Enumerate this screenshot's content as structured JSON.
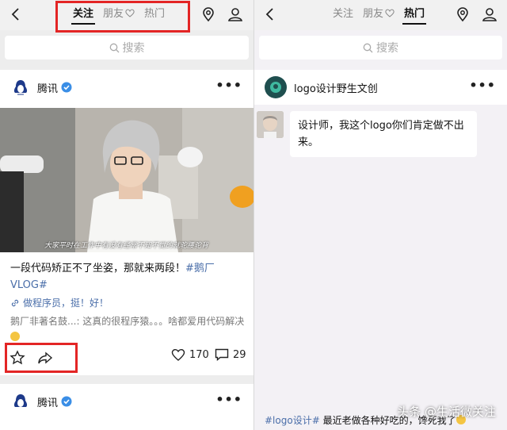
{
  "left": {
    "tabs": [
      {
        "label": "关注",
        "active": true
      },
      {
        "label": "朋友",
        "active": false,
        "icon": "heart-outline-icon"
      },
      {
        "label": "热门",
        "active": false
      }
    ],
    "search_placeholder": "搜索",
    "post": {
      "author": "腾讯",
      "video_caption": "大家平时在工作中有没有经常不知不觉的就驼腰驼背",
      "text": "一段代码矫正不了坐姿，那就来两段！",
      "hashtag": "#鹅厂VLOG#",
      "link": "做程序员，挺！好！",
      "comment": "鹅厂非著名鼓...: 这真的很程序猿。。。啥都爱用代码解决",
      "likes": "170",
      "comments": "29"
    },
    "next_post_author": "腾讯"
  },
  "right": {
    "tabs": [
      {
        "label": "关注",
        "active": false
      },
      {
        "label": "朋友",
        "active": false,
        "icon": "heart-outline-icon"
      },
      {
        "label": "热门",
        "active": true
      }
    ],
    "search_placeholder": "搜索",
    "author": "logo设计野生文创",
    "bubble_text": "设计师，我这个logo你们肯定做不出来。",
    "footer_hashtag": "#logo设计#",
    "footer_text": "最近老做各种好吃的，馋死我了",
    "watermark": "头条 @生活微关注"
  },
  "colors": {
    "highlight_box": "#e32525",
    "link_blue": "#4a6ea9",
    "verified_blue": "#3a8ee6"
  }
}
